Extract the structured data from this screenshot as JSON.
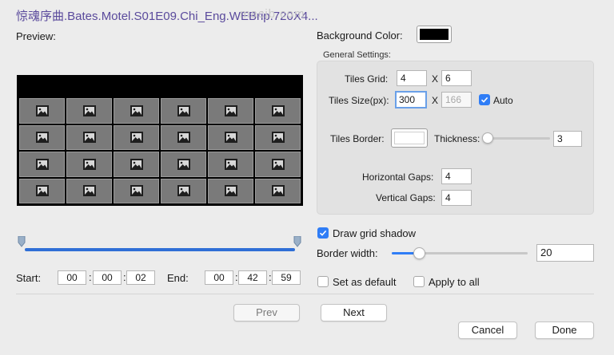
{
  "window": {
    "title": "惊魂序曲.Bates.Motel.S01E09.Chi_Eng.WEBrip.720X4...",
    "watermark": "macjb.com"
  },
  "preview": {
    "label": "Preview:",
    "rows": 4,
    "cols": 6,
    "tile_icon": "image-icon"
  },
  "range": {
    "start_label": "Start:",
    "start": [
      "00",
      "00",
      "02"
    ],
    "end_label": "End:",
    "end": [
      "00",
      "42",
      "59"
    ],
    "separator": ":"
  },
  "settings": {
    "background_color_label": "Background Color:",
    "background_color": "#000000",
    "group_label": "General Settings:",
    "tiles_grid_label": "Tiles Grid:",
    "tiles_grid_cols": "4",
    "tiles_grid_rows": "6",
    "x_sep": "X",
    "tiles_size_label": "Tiles Size(px):",
    "tiles_size_w": "300",
    "tiles_size_h": "166",
    "auto_label": "Auto",
    "auto_checked": true,
    "tiles_border_label": "Tiles Border:",
    "tiles_border_color": "#ffffff",
    "thickness_label": "Thickness:",
    "thickness_value": "3",
    "thickness_fraction": 0.05,
    "horizontal_gaps_label": "Horizontal Gaps:",
    "horizontal_gaps": "4",
    "vertical_gaps_label": "Vertical Gaps:",
    "vertical_gaps": "4",
    "draw_grid_shadow_label": "Draw grid shadow",
    "draw_grid_shadow_checked": true,
    "border_width_label": "Border width:",
    "border_width_value": "20",
    "border_width_fraction": 0.2,
    "set_default_label": "Set as default",
    "apply_all_label": "Apply to all"
  },
  "buttons": {
    "prev": "Prev",
    "next": "Next",
    "cancel": "Cancel",
    "done": "Done"
  },
  "colors": {
    "accent": "#2f7df6",
    "title": "#5a4a9c"
  }
}
